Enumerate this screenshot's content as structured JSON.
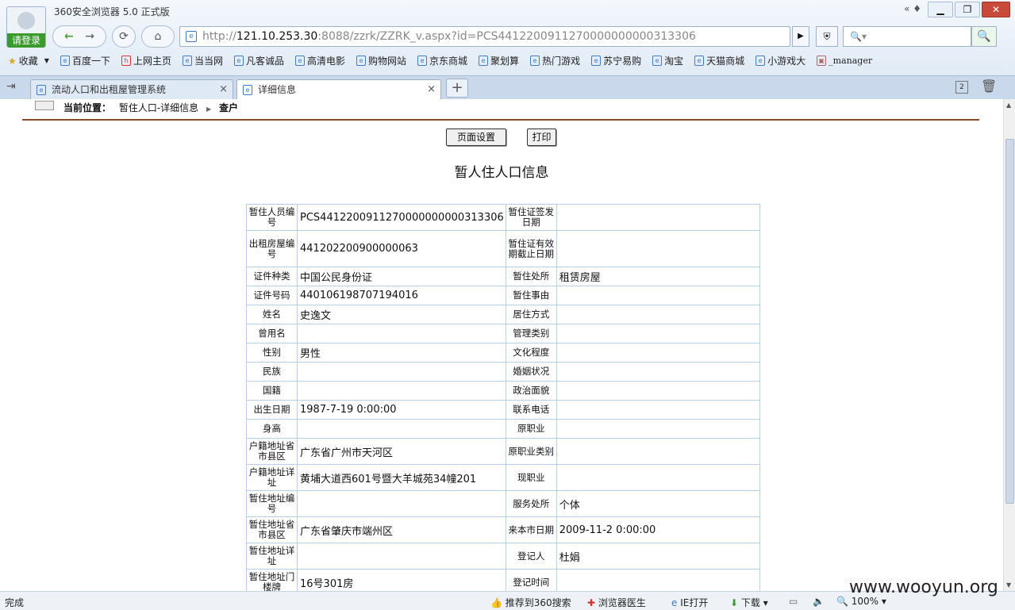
{
  "window": {
    "title": "360安全浏览器 5.0 正式版",
    "login": "请登录",
    "min": "▁",
    "restore": "❐",
    "close": "✕",
    "skin": "« ♦"
  },
  "nav": {
    "back": "←",
    "forward": "→",
    "refresh": "⟳",
    "home": "⌂"
  },
  "address": {
    "url_prefix": "http://",
    "url_host": "121.10.253.30",
    "url_rest": ":8088/zzrk/ZZRK_v.aspx?id=PCS4412200911270000000000313306",
    "go": "▶"
  },
  "search": {
    "placeholder": "🔍▾",
    "button": "🔍"
  },
  "bookmarks": {
    "favorites": "收藏",
    "items": [
      "百度一下",
      "上网主页",
      "当当网",
      "凡客诚品",
      "高清电影",
      "购物网站",
      "京东商城",
      "聚划算",
      "热门游戏",
      "苏宁易购",
      "淘宝",
      "天猫商城",
      "小游戏大",
      "_manager"
    ]
  },
  "tabs": [
    {
      "label": "流动人口和出租屋管理系统"
    },
    {
      "label": "详细信息"
    }
  ],
  "page": {
    "breadcrumb_label": "当前位置：",
    "breadcrumb_path": "暂住人口-详细信息",
    "breadcrumb_current": "查户",
    "btn_setup": "页面设置",
    "btn_print": "打印",
    "title": "暂人住人口信息"
  },
  "rows": [
    {
      "l1": "暂住人员编号",
      "v1": "PCS4412200911270000000000313306",
      "l2": "暂住证签发日期",
      "v2": ""
    },
    {
      "l1": "出租房屋编号",
      "v1": "441202200900000063",
      "l2": "暂住证有效期截止日期",
      "v2": ""
    },
    {
      "l1": "证件种类",
      "v1": "中国公民身份证",
      "l2": "暂住处所",
      "v2": "租赁房屋"
    },
    {
      "l1": "证件号码",
      "v1": "440106198707194016",
      "l2": "暂住事由",
      "v2": ""
    },
    {
      "l1": "姓名",
      "v1": "史逸文",
      "l2": "居住方式",
      "v2": ""
    },
    {
      "l1": "曾用名",
      "v1": "",
      "l2": "管理类别",
      "v2": ""
    },
    {
      "l1": "性别",
      "v1": "男性",
      "l2": "文化程度",
      "v2": ""
    },
    {
      "l1": "民族",
      "v1": "",
      "l2": "婚姻状况",
      "v2": ""
    },
    {
      "l1": "国籍",
      "v1": "",
      "l2": "政治面貌",
      "v2": ""
    },
    {
      "l1": "出生日期",
      "v1": "1987-7-19 0:00:00",
      "l2": "联系电话",
      "v2": ""
    },
    {
      "l1": "身高",
      "v1": "",
      "l2": "原职业",
      "v2": ""
    },
    {
      "l1": "户籍地址省市县区",
      "v1": "广东省广州市天河区",
      "l2": "原职业类别",
      "v2": ""
    },
    {
      "l1": "户籍地址详址",
      "v1": "黄埔大道西601号暨大羊城苑34幢201",
      "l2": "现职业",
      "v2": ""
    },
    {
      "l1": "暂住地址编号",
      "v1": "",
      "l2": "服务处所",
      "v2": "个体"
    },
    {
      "l1": "暂住地址省市县区",
      "v1": "广东省肇庆市端州区",
      "l2": "来本市日期",
      "v2": "2009-11-2 0:00:00"
    },
    {
      "l1": "暂住地址详址",
      "v1": "",
      "l2": "登记人",
      "v2": "杜娟"
    },
    {
      "l1": "暂住地址门楼牌",
      "v1": "16号301房",
      "l2": "登记时间",
      "v2": ""
    }
  ],
  "status": {
    "done": "完成",
    "recommend": "推荐到360搜索",
    "doctor": "浏览器医生",
    "ie_open": "IE打开",
    "download": "下载",
    "zoom": "100%"
  },
  "watermark": "www.wooyun.org"
}
